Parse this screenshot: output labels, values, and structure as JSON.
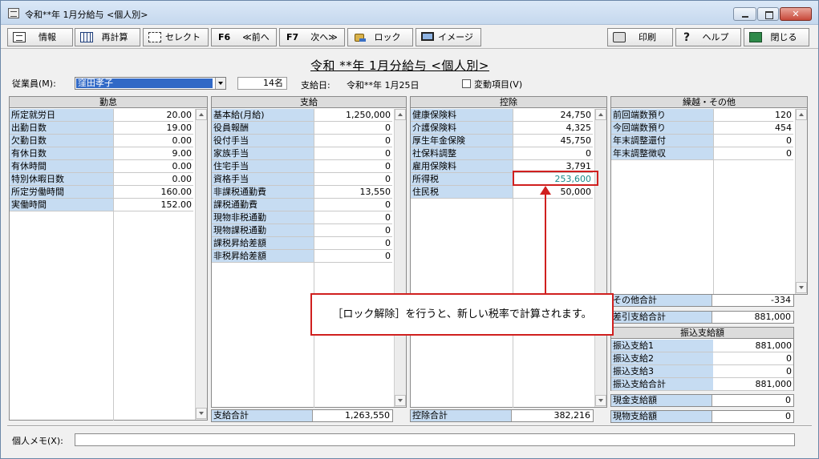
{
  "window": {
    "title": "令和**年 1月分給与 <個人別>"
  },
  "toolbar": {
    "info": "情報",
    "recalc": "再計算",
    "select": "セレクト",
    "f6_key": "F6",
    "prev": "≪前へ",
    "f7_key": "F7",
    "next": "次へ≫",
    "lock": "ロック",
    "image": "イメージ",
    "print": "印刷",
    "help": "ヘルプ",
    "close": "閉じる"
  },
  "heading": "令和 **年 1月分給与 <個人別>",
  "employee": {
    "label": "従業員(M):",
    "name": "窪田孝子",
    "count": "14名",
    "pay_label": "支給日:",
    "pay_date": "令和**年 1月25日",
    "variable_label": "変動項目(V)"
  },
  "attendance": {
    "title": "勤怠",
    "rows": [
      {
        "label": "所定就労日",
        "value": "20.00"
      },
      {
        "label": "出勤日数",
        "value": "19.00"
      },
      {
        "label": "欠勤日数",
        "value": "0.00"
      },
      {
        "label": "有休日数",
        "value": "9.00"
      },
      {
        "label": "有休時間",
        "value": "0.00"
      },
      {
        "label": "特別休暇日数",
        "value": "0.00"
      },
      {
        "label": "所定労働時間",
        "value": "160.00"
      },
      {
        "label": "実働時間",
        "value": "152.00"
      }
    ]
  },
  "payment": {
    "title": "支給",
    "rows": [
      {
        "label": "基本給(月給)",
        "value": "1,250,000"
      },
      {
        "label": "役員報酬",
        "value": "0"
      },
      {
        "label": "役付手当",
        "value": "0"
      },
      {
        "label": "家族手当",
        "value": "0"
      },
      {
        "label": "住宅手当",
        "value": "0"
      },
      {
        "label": "資格手当",
        "value": "0"
      },
      {
        "label": "非課税通勤費",
        "value": "13,550"
      },
      {
        "label": "課税通勤費",
        "value": "0"
      },
      {
        "label": "現物非税通勤",
        "value": "0"
      },
      {
        "label": "現物課税通勤",
        "value": "0"
      },
      {
        "label": "課税昇給差額",
        "value": "0"
      },
      {
        "label": "非税昇給差額",
        "value": "0"
      }
    ],
    "total_label": "支給合計",
    "total_value": "1,263,550"
  },
  "deduction": {
    "title": "控除",
    "rows": [
      {
        "label": "健康保険料",
        "value": "24,750"
      },
      {
        "label": "介護保険料",
        "value": "4,325"
      },
      {
        "label": "厚生年金保険",
        "value": "45,750"
      },
      {
        "label": "社保料調整",
        "value": "0"
      },
      {
        "label": "雇用保険料",
        "value": "3,791"
      },
      {
        "label": "所得税",
        "value": "253,600"
      },
      {
        "label": "住民税",
        "value": "50,000"
      }
    ],
    "total_label": "控除合計",
    "total_value": "382,216"
  },
  "other": {
    "title": "繰越・その他",
    "rows": [
      {
        "label": "前回端数預り",
        "value": "120"
      },
      {
        "label": "今回端数預り",
        "value": "454"
      },
      {
        "label": "年末調整還付",
        "value": "0"
      },
      {
        "label": "年末調整徴収",
        "value": "0"
      }
    ],
    "total_label": "その他合計",
    "total_value": "-334",
    "net_label": "差引支給合計",
    "net_value": "881,000"
  },
  "transfer": {
    "title": "振込支給額",
    "rows": [
      {
        "label": "振込支給1",
        "value": "881,000"
      },
      {
        "label": "振込支給2",
        "value": "0"
      },
      {
        "label": "振込支給3",
        "value": "0"
      },
      {
        "label": "振込支給合計",
        "value": "881,000"
      }
    ],
    "cash_label": "現金支給額",
    "cash_value": "0",
    "goods_label": "現物支給額",
    "goods_value": "0"
  },
  "callout": "［ロック解除］を行うと、新しい税率で計算されます。",
  "memo": {
    "label": "個人メモ(X):",
    "value": ""
  },
  "colors": {
    "highlight": "#d0201f",
    "label_bg": "#c6dcf2",
    "selection": "#3169c6",
    "income_tax_text": "#1a8a8a"
  }
}
